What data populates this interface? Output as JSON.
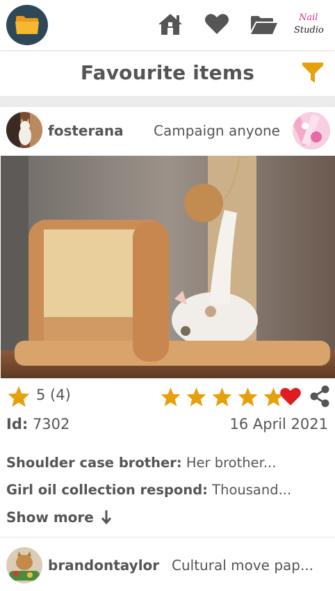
{
  "header": {
    "app_icon": "folder-icon",
    "nav_icons": [
      "home-icon",
      "heart-icon",
      "folder-open-icon"
    ],
    "brand_text_1": "Nail",
    "brand_text_2": "Studio"
  },
  "page": {
    "title": "Favourite items",
    "filter_icon": "filter-icon"
  },
  "card": {
    "username": "fosterana",
    "campaign": "Campaign anyone",
    "rating_display": "5 (4)",
    "stars_filled": 5,
    "id_label": "Id:",
    "id_value": "7302",
    "date": "16 April 2021",
    "details": [
      {
        "label": "Shoulder case brother:",
        "value": "Her brother..."
      },
      {
        "label": "Girl oil collection respond:",
        "value": "Thousand..."
      }
    ],
    "show_more": "Show more"
  },
  "next_card": {
    "username": "brandontaylor",
    "campaign": "Cultural move pap..."
  },
  "colors": {
    "accent": "#e5a00d",
    "heart": "#e01b22",
    "icon_gray": "#555555",
    "logo_bg": "#2f4858",
    "folder": "#f7b731"
  }
}
